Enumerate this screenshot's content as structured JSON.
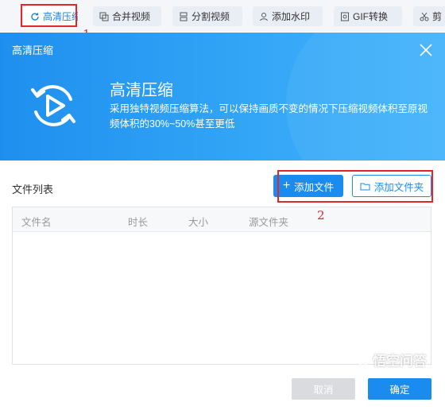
{
  "toolbar": {
    "items": [
      {
        "label": "高清压缩",
        "icon": "compress-refresh-icon"
      },
      {
        "label": "合并视频",
        "icon": "merge-icon"
      },
      {
        "label": "分割视频",
        "icon": "split-icon"
      },
      {
        "label": "添加水印",
        "icon": "watermark-icon"
      },
      {
        "label": "GIF转换",
        "icon": "gif-icon"
      },
      {
        "label": "剪",
        "icon": "scissors-icon"
      }
    ]
  },
  "annotations": {
    "n1": "1",
    "n2": "2"
  },
  "dialog": {
    "title": "高清压缩",
    "hero_title": "高清压缩",
    "hero_desc": "采用独特视频压缩算法，可以保持画质不变的情况下压缩视频体积至原视频体积的30%~50%甚至更低",
    "file_list_label": "文件列表",
    "add_file": "添加文件",
    "add_folder": "添加文件夹",
    "columns": [
      "文件名",
      "时长",
      "大小",
      "源文件夹"
    ],
    "cancel": "取消",
    "ok": "确定"
  },
  "watermark": {
    "text": "悟空问答"
  },
  "colors": {
    "accent": "#1a8cf0",
    "annotation": "#e3262b"
  }
}
